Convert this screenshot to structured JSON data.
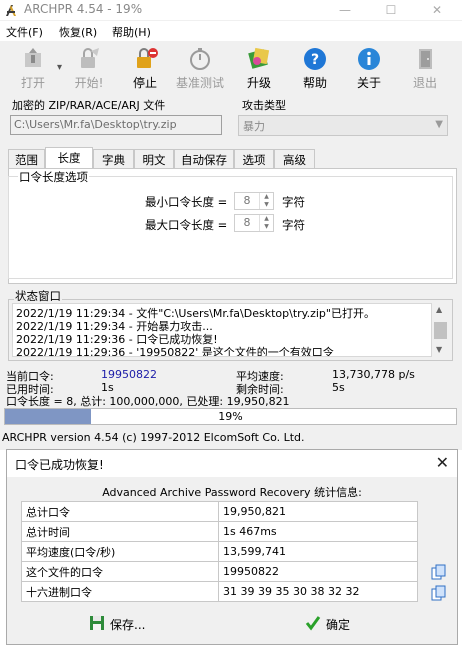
{
  "window": {
    "title": "ARCHPR 4.54 - 19%"
  },
  "title_controls": {
    "minimize": "—",
    "maximize": "☐",
    "close": "✕"
  },
  "menu": [
    "文件(F)",
    "恢复(R)",
    "帮助(H)"
  ],
  "toolbar": {
    "open": "打开",
    "start": "开始!",
    "stop": "停止",
    "benchmark": "基准测试",
    "upgrade": "升级",
    "help": "帮助",
    "about": "关于",
    "exit": "退出"
  },
  "encrypted_file": {
    "label": "加密的 ZIP/RAR/ACE/ARJ 文件",
    "path": "C:\\Users\\Mr.fa\\Desktop\\try.zip"
  },
  "attack_type": {
    "label": "攻击类型",
    "value": "暴力"
  },
  "tabs": [
    "范围",
    "长度",
    "字典",
    "明文",
    "自动保存",
    "选项",
    "高级"
  ],
  "length_options": {
    "title": "口令长度选项",
    "min_label": "最小口令长度 =",
    "min_value": "8",
    "max_label": "最大口令长度 =",
    "max_value": "8",
    "unit": "字符"
  },
  "status_window": {
    "title": "状态窗口",
    "log": [
      "2022/1/19 11:29:34 - 文件\"C:\\Users\\Mr.fa\\Desktop\\try.zip\"已打开。",
      "2022/1/19 11:29:34 - 开始暴力攻击...",
      "2022/1/19 11:29:36 - 口令已成功恢复!",
      "2022/1/19 11:29:36 - '19950822' 是这个文件的一个有效口令"
    ]
  },
  "stats": {
    "current_password_label": "当前口令:",
    "current_password": "19950822",
    "avg_speed_label": "平均速度:",
    "avg_speed": "13,730,778 p/s",
    "elapsed_label": "已用时间:",
    "elapsed": "1s",
    "remaining_label": "剩余时间:",
    "remaining": "5s",
    "summary": "口令长度 = 8, 总计: 100,000,000, 已处理: 19,950,821"
  },
  "progress": {
    "percent": 19,
    "text": "19%"
  },
  "version_text": "ARCHPR version 4.54 (c) 1997-2012 ElcomSoft Co. Ltd.",
  "dialog": {
    "title": "口令已成功恢复!",
    "close": "✕",
    "heading": "Advanced Archive Password Recovery 统计信息:",
    "rows": [
      {
        "key": "总计口令",
        "value": "19,950,821"
      },
      {
        "key": "总计时间",
        "value": "1s 467ms"
      },
      {
        "key": "平均速度(口令/秒)",
        "value": "13,599,741"
      },
      {
        "key": "这个文件的口令",
        "value": "19950822"
      },
      {
        "key": "十六进制口令",
        "value": "31 39 39 35 30 38 32 32"
      }
    ],
    "save_label": "保存...",
    "ok_label": "确定"
  },
  "colors": {
    "progress_fill": "#7f96c4",
    "accent_blue": "#1c1ca8"
  }
}
